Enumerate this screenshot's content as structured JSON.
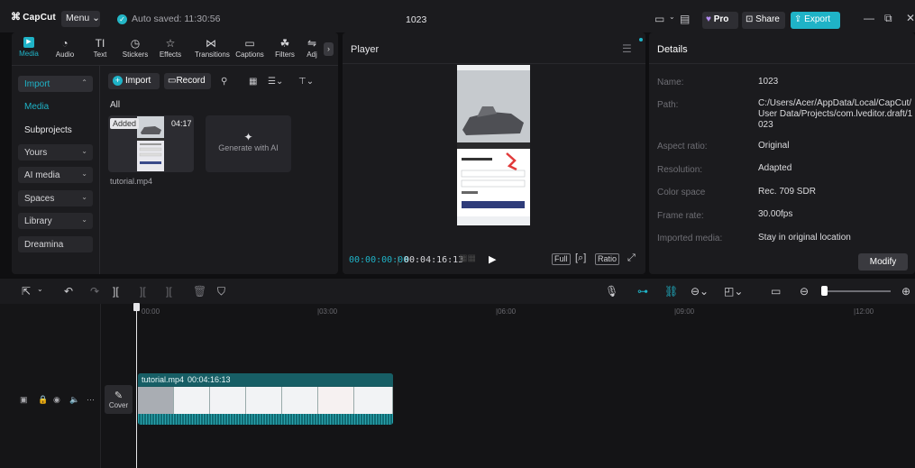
{
  "titlebar": {
    "logo": "CapCut",
    "menu_label": "Menu",
    "autosave": "Auto saved: 11:30:56",
    "project_title": "1023",
    "pro_label": "Pro",
    "share_label": "Share",
    "export_label": "Export"
  },
  "tabs": [
    {
      "label": "Media",
      "icon": "media-icon"
    },
    {
      "label": "Audio",
      "icon": "audio-icon"
    },
    {
      "label": "Text",
      "icon": "text-icon"
    },
    {
      "label": "Stickers",
      "icon": "stickers-icon"
    },
    {
      "label": "Effects",
      "icon": "effects-icon"
    },
    {
      "label": "Transitions",
      "icon": "transitions-icon"
    },
    {
      "label": "Captions",
      "icon": "captions-icon"
    },
    {
      "label": "Filters",
      "icon": "filters-icon"
    },
    {
      "label": "Adj",
      "icon": "adjust-icon"
    }
  ],
  "sidebar": {
    "import": "Import",
    "media": "Media",
    "subprojects": "Subprojects",
    "yours": "Yours",
    "ai_media": "AI media",
    "spaces": "Spaces",
    "library": "Library",
    "dreamina": "Dreamina"
  },
  "media": {
    "import_btn": "Import",
    "record_btn": "Record",
    "filter_all": "All",
    "item": {
      "badge": "Added",
      "duration": "04:17",
      "name": "tutorial.mp4"
    },
    "generate_label": "Generate with AI"
  },
  "player": {
    "title": "Player",
    "current_time": "00:00:00:00",
    "total_time": "00:04:16:13",
    "full_label": "Full",
    "ratio_label": "Ratio"
  },
  "details": {
    "title": "Details",
    "rows": [
      {
        "label": "Name:",
        "value": "1023"
      },
      {
        "label": "Path:",
        "value": "C:/Users/Acer/AppData/Local/CapCut/User Data/Projects/com.lveditor.draft/1023"
      },
      {
        "label": "Aspect ratio:",
        "value": "Original"
      },
      {
        "label": "Resolution:",
        "value": "Adapted"
      },
      {
        "label": "Color space",
        "value": "Rec. 709 SDR"
      },
      {
        "label": "Frame rate:",
        "value": "30.00fps"
      },
      {
        "label": "Imported media:",
        "value": "Stay in original location"
      }
    ],
    "modify_btn": "Modify"
  },
  "timeline": {
    "ruler": [
      "00:00",
      "|03:00",
      "|06:00",
      "|09:00",
      "|12:00"
    ],
    "cover_label": "Cover",
    "clip_name": "tutorial.mp4",
    "clip_duration": "00:04:16:13"
  },
  "colors": {
    "accent": "#1fb3c7",
    "bg": "#0f0f11",
    "panel": "#1b1b1e"
  }
}
